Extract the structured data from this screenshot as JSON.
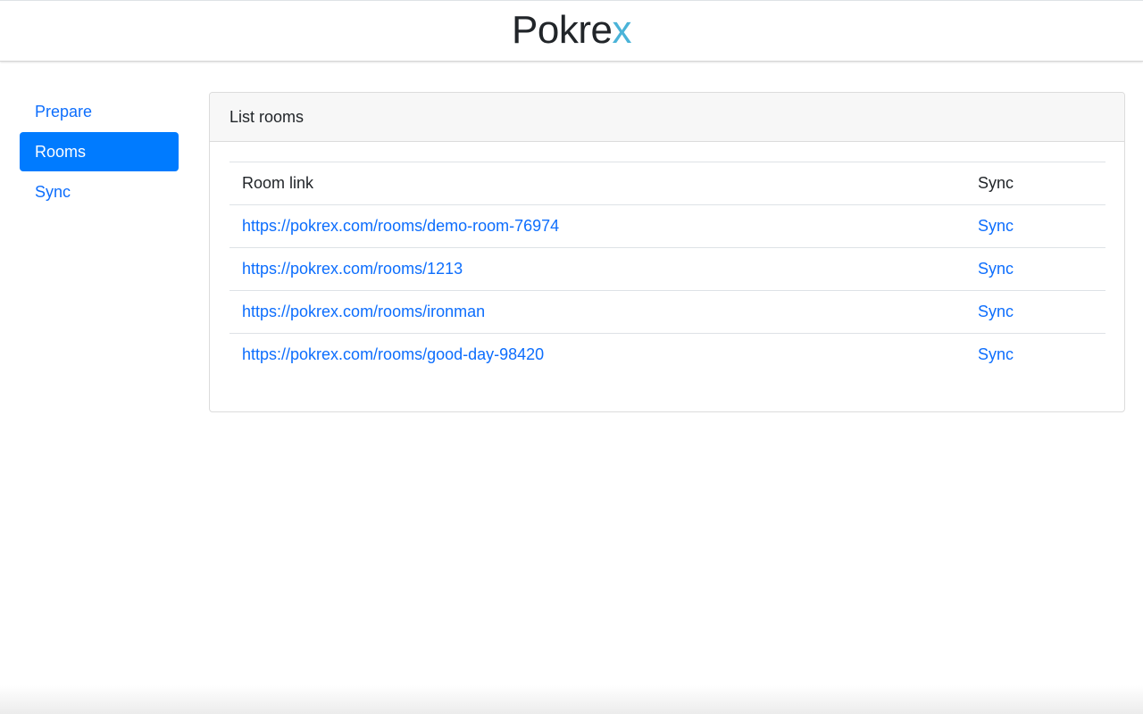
{
  "brand": {
    "main": "Pokre",
    "accent": "x",
    "accent_color": "#4ab3d8"
  },
  "sidebar": {
    "items": [
      {
        "label": "Prepare",
        "active": false
      },
      {
        "label": "Rooms",
        "active": true
      },
      {
        "label": "Sync",
        "active": false
      }
    ]
  },
  "card": {
    "title": "List rooms",
    "table": {
      "headers": [
        "Room link",
        "Sync"
      ],
      "rows": [
        {
          "link": "https://pokrex.com/rooms/demo-room-76974",
          "sync": "Sync"
        },
        {
          "link": "https://pokrex.com/rooms/1213",
          "sync": "Sync"
        },
        {
          "link": "https://pokrex.com/rooms/ironman",
          "sync": "Sync"
        },
        {
          "link": "https://pokrex.com/rooms/good-day-98420",
          "sync": "Sync"
        }
      ]
    }
  },
  "colors": {
    "link": "#0d6efd",
    "active_nav": "#007bff"
  }
}
